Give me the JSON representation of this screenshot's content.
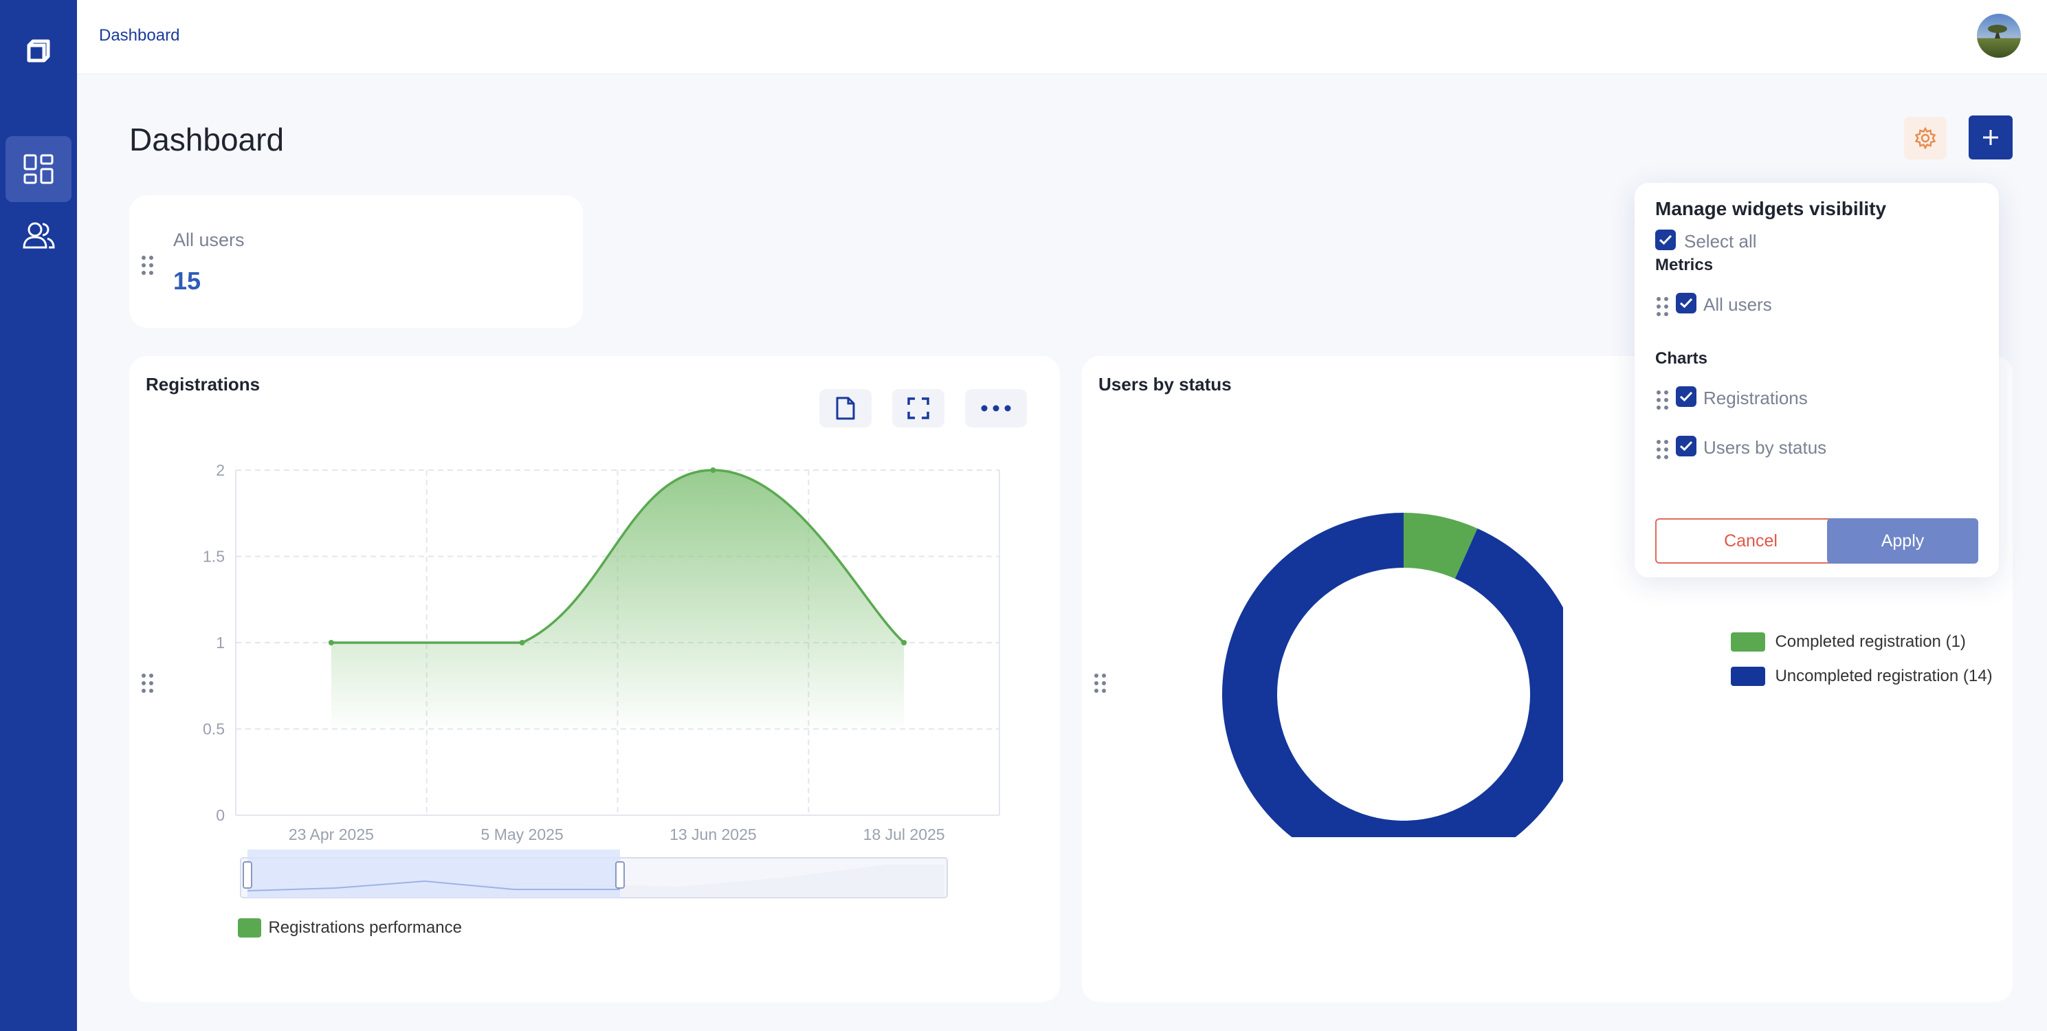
{
  "breadcrumb": "Dashboard",
  "page_title": "Dashboard",
  "colors": {
    "sidebar": "#1a3a9c",
    "accent": "#1a3a9c",
    "green": "#5aa951",
    "blue": "#14369a",
    "cancel": "#e0574a"
  },
  "metric": {
    "label": "All users",
    "value": "15"
  },
  "registrations": {
    "title": "Registrations",
    "legend": "Registrations performance",
    "y_ticks": [
      "0",
      "0.5",
      "1",
      "1.5",
      "2"
    ],
    "x_ticks": [
      "23 Apr 2025",
      "5 May 2025",
      "13 Jun 2025",
      "18 Jul 2025"
    ]
  },
  "status": {
    "title": "Users by status",
    "legend": [
      "Completed registration (1)",
      "Uncompleted registration (14)"
    ]
  },
  "popover": {
    "title": "Manage widgets visibility",
    "select_all": "Select all",
    "metrics_heading": "Metrics",
    "metrics_items": [
      "All users"
    ],
    "charts_heading": "Charts",
    "charts_items": [
      "Registrations",
      "Users by status"
    ],
    "cancel": "Cancel",
    "apply": "Apply"
  },
  "chart_data": [
    {
      "type": "area",
      "title": "Registrations",
      "x": [
        "23 Apr 2025",
        "5 May 2025",
        "13 Jun 2025",
        "18 Jul 2025"
      ],
      "series": [
        {
          "name": "Registrations performance",
          "values": [
            1,
            1,
            2,
            1
          ]
        }
      ],
      "ylim": [
        0,
        2
      ],
      "grid": true,
      "legend_position": "bottom-left"
    },
    {
      "type": "pie",
      "title": "Users by status",
      "categories": [
        "Completed registration",
        "Uncompleted registration"
      ],
      "values": [
        1,
        14
      ],
      "legend_position": "right"
    }
  ]
}
